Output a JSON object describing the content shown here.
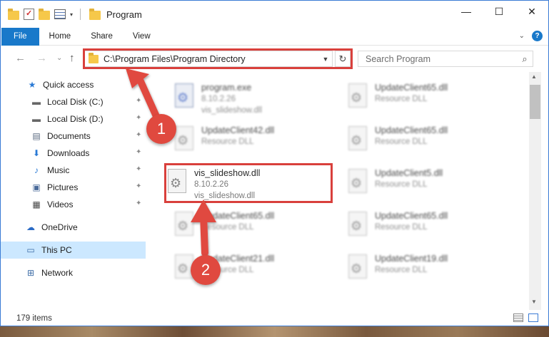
{
  "window": {
    "title": "Program",
    "controls": {
      "minimize": "—",
      "maximize": "☐",
      "close": "✕"
    }
  },
  "ribbon": {
    "tabs": [
      "File",
      "Home",
      "Share",
      "View"
    ],
    "expand_icon": "chevron-down",
    "help": "?"
  },
  "nav": {
    "back": "←",
    "forward": "→",
    "recent": "⌄",
    "up": "↑",
    "address": "C:\\Program Files\\Program Directory",
    "refresh": "↻",
    "search_placeholder": "Search Program",
    "search_icon": "⌕"
  },
  "sidebar": {
    "items": [
      {
        "label": "Quick access",
        "icon": "★",
        "pinned": false
      },
      {
        "label": "Local Disk (C:)",
        "icon": "▬",
        "pinned": true
      },
      {
        "label": "Local Disk (D:)",
        "icon": "▬",
        "pinned": true
      },
      {
        "label": "Documents",
        "icon": "▤",
        "pinned": true
      },
      {
        "label": "Downloads",
        "icon": "⬇",
        "pinned": true
      },
      {
        "label": "Music",
        "icon": "♪",
        "pinned": true
      },
      {
        "label": "Pictures",
        "icon": "▣",
        "pinned": true
      },
      {
        "label": "Videos",
        "icon": "▦",
        "pinned": true
      },
      {
        "label": "OneDrive",
        "icon": "☁",
        "pinned": false
      },
      {
        "label": "This PC",
        "icon": "▭",
        "pinned": false,
        "selected": true
      },
      {
        "label": "Network",
        "icon": "⊞",
        "pinned": false
      }
    ],
    "pin_glyph": "📌"
  },
  "files": {
    "left_column": [
      {
        "name": "program.exe",
        "line2": "8.10.2.26",
        "line3": "vis_slideshow.dll",
        "type": "exe"
      },
      {
        "name": "UpdateClient42.dll",
        "line2": "Resource DLL",
        "line3": ""
      },
      {
        "name": "vis_slideshow.dll",
        "line2": "8.10.2.26",
        "line3": "vis_slideshow.dll",
        "highlighted": true
      },
      {
        "name": "UpdateClient65.dll",
        "line2": "Resource DLL",
        "line3": ""
      },
      {
        "name": "UpdateClient21.dll",
        "line2": "Resource DLL",
        "line3": ""
      }
    ],
    "right_column": [
      {
        "name": "UpdateClient65.dll",
        "line2": "Resource DLL"
      },
      {
        "name": "UpdateClient65.dll",
        "line2": "Resource DLL"
      },
      {
        "name": "UpdateClient5.dll",
        "line2": "Resource DLL"
      },
      {
        "name": "UpdateClient65.dll",
        "line2": "Resource DLL"
      },
      {
        "name": "UpdateClient19.dll",
        "line2": "Resource DLL"
      }
    ]
  },
  "status": {
    "item_count": "179 items"
  },
  "annotations": {
    "step1": "1",
    "step2": "2",
    "color": "#d9403c"
  }
}
